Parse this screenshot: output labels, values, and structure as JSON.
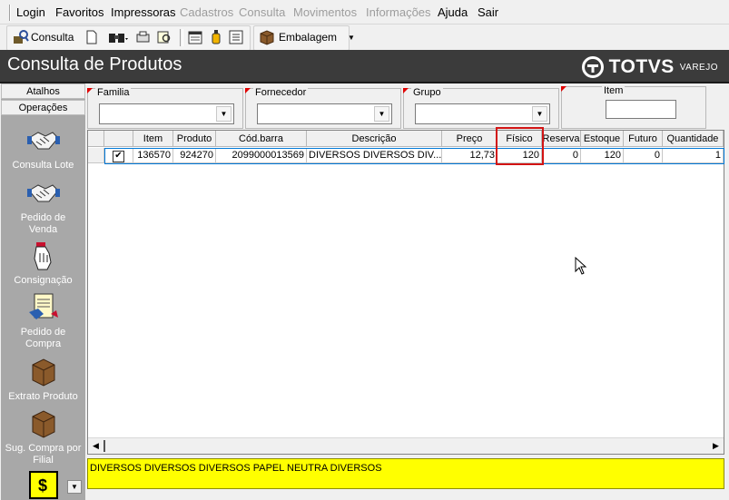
{
  "menu": [
    {
      "label": "Login",
      "disabled": false
    },
    {
      "label": "Favoritos",
      "disabled": false
    },
    {
      "label": "Impressoras",
      "disabled": false
    },
    {
      "label": "Cadastros",
      "disabled": true
    },
    {
      "label": "Consulta",
      "disabled": true
    },
    {
      "label": "Movimentos",
      "disabled": true
    },
    {
      "label": "Informações",
      "disabled": true
    },
    {
      "label": "Ajuda",
      "disabled": false
    },
    {
      "label": "Sair",
      "disabled": false
    }
  ],
  "toolbar": {
    "consulta_label": "Consulta",
    "embalagem_label": "Embalagem"
  },
  "title": "Consulta de Produtos",
  "brand": {
    "name": "TOTVS",
    "sub": "VAREJO"
  },
  "sidebar": {
    "tabs": [
      "Atalhos",
      "Operações"
    ],
    "items": [
      {
        "label": "Consulta Lote",
        "icon": "handshake-icon"
      },
      {
        "label": "Pedido de Venda",
        "icon": "handshake-icon"
      },
      {
        "label": "Consignação",
        "icon": "hand-pointer-icon"
      },
      {
        "label": "Pedido de Compra",
        "icon": "purchase-order-icon"
      },
      {
        "label": "Extrato Produto",
        "icon": "package-box-icon"
      },
      {
        "label": "Sug. Compra por Filial",
        "icon": "package-box-icon"
      }
    ]
  },
  "filters": {
    "familia": "Familia",
    "fornecedor": "Fornecedor",
    "grupo": "Grupo",
    "item": "Item"
  },
  "grid": {
    "columns": [
      "Item",
      "Produto",
      "Cód.barra",
      "Descrição",
      "Preço",
      "Físico",
      "Reserva",
      "Estoque",
      "Futuro",
      "Quantidade"
    ],
    "rows": [
      {
        "checked": true,
        "item": "136570",
        "produto": "924270",
        "codbarra": "2099000013569",
        "descricao": "DIVERSOS DIVERSOS DIV...",
        "preco": "12,73",
        "fisico": "120",
        "reserva": "0",
        "estoque": "120",
        "futuro": "0",
        "quantidade": "1"
      }
    ]
  },
  "status_text": "DIVERSOS DIVERSOS DIVERSOS PAPEL NEUTRA DIVERSOS",
  "colors": {
    "title_bg": "#3b3b3b",
    "status_bg": "#ffff00",
    "highlight": "#d21414",
    "sidebar_bg": "#a8a8a8"
  }
}
